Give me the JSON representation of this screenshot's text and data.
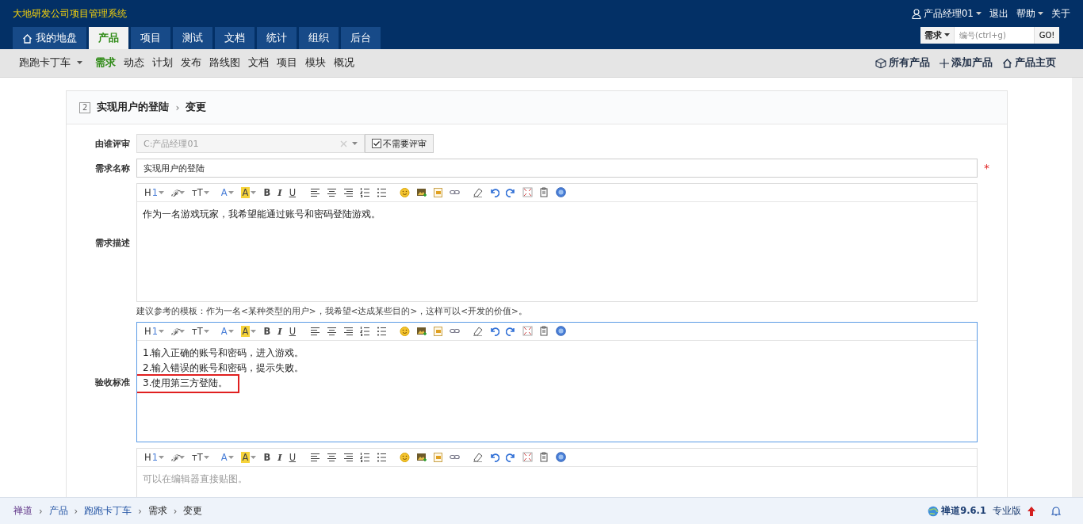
{
  "header": {
    "system_title": "大地研发公司项目管理系统",
    "user": "产品经理01",
    "links": [
      {
        "label": "退出",
        "menu": false
      },
      {
        "label": "帮助",
        "menu": true
      },
      {
        "label": "关于",
        "menu": false
      }
    ],
    "tabs": [
      {
        "label": "我的地盘",
        "selected": false,
        "home": true
      },
      {
        "label": "产品",
        "selected": true
      },
      {
        "label": "项目",
        "selected": false
      },
      {
        "label": "测试",
        "selected": false
      },
      {
        "label": "文档",
        "selected": false
      },
      {
        "label": "统计",
        "selected": false
      },
      {
        "label": "组织",
        "selected": false
      },
      {
        "label": "后台",
        "selected": false
      }
    ],
    "search": {
      "type": "需求",
      "placeholder": "编号(ctrl+g)",
      "button": "GO!"
    }
  },
  "subnav": {
    "product": "跑跑卡丁车",
    "items": [
      {
        "label": "需求",
        "selected": true
      },
      {
        "label": "动态",
        "selected": false
      },
      {
        "label": "计划",
        "selected": false
      },
      {
        "label": "发布",
        "selected": false
      },
      {
        "label": "路线图",
        "selected": false
      },
      {
        "label": "文档",
        "selected": false
      },
      {
        "label": "项目",
        "selected": false
      },
      {
        "label": "模块",
        "selected": false
      },
      {
        "label": "概况",
        "selected": false
      }
    ],
    "actions": [
      {
        "kind": "box",
        "label": "所有产品"
      },
      {
        "kind": "plus",
        "label": "添加产品"
      },
      {
        "kind": "home",
        "label": "产品主页"
      }
    ]
  },
  "form": {
    "story_id": "2",
    "story_title": "实现用户的登陆",
    "separator": "›",
    "action": "变更",
    "reviewer": {
      "label": "由谁评审",
      "value": "C:产品经理01",
      "disabled": true,
      "no_review": {
        "label": "不需要评审",
        "checked": true
      }
    },
    "name": {
      "label": "需求名称",
      "value": "实现用户的登陆",
      "required_mark": "*"
    },
    "editors": [
      {
        "label": "需求描述",
        "toolbar": [
          "H1",
          "ℱ",
          "тT",
          "A",
          "A",
          "B",
          "I",
          "U"
        ],
        "focused": false,
        "lines": [
          {
            "text": "作为一名游戏玩家，我希望能通过账号和密码登陆游戏。",
            "highlighted": false
          }
        ],
        "hint": "建议参考的模板：作为一名<某种类型的用户>，我希望<达成某些目的>，这样可以<开发的价值>。"
      },
      {
        "label": "验收标准",
        "toolbar": [
          "H1",
          "ℱ",
          "тT",
          "A",
          "A",
          "B",
          "I",
          "U"
        ],
        "focused": true,
        "lines": [
          {
            "text": "1.输入正确的账号和密码，进入游戏。",
            "highlighted": false
          },
          {
            "text": "2.输入错误的账号和密码，提示失败。",
            "highlighted": false
          },
          {
            "text": "3.使用第三方登陆。",
            "highlighted": true
          }
        ]
      },
      {
        "toolbar": [
          "H1",
          "ℱ",
          "тT",
          "A",
          "A",
          "B",
          "I",
          "U"
        ],
        "focused": false,
        "placeholder": "可以在编辑器直接贴图。"
      }
    ]
  },
  "footer": {
    "breadcrumb": [
      "禅道",
      "产品",
      "跑跑卡丁车",
      "需求",
      "变更"
    ],
    "separators": [
      "›",
      "›",
      "›",
      "›"
    ],
    "version": "禅道9.6.1",
    "edition": "专业版"
  }
}
